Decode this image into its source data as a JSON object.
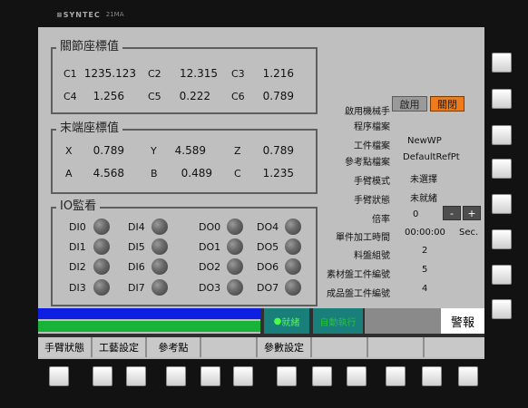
{
  "joint": {
    "title": "關節座標值",
    "items": [
      {
        "label": "C1",
        "value": "1235.123"
      },
      {
        "label": "C2",
        "value": "12.315"
      },
      {
        "label": "C3",
        "value": "1.216"
      },
      {
        "label": "C4",
        "value": "1.256"
      },
      {
        "label": "C5",
        "value": "0.222"
      },
      {
        "label": "C6",
        "value": "0.789"
      }
    ]
  },
  "endcoord": {
    "title": "末端座標值",
    "items": [
      {
        "label": "X",
        "value": "0.789"
      },
      {
        "label": "Y",
        "value": "4.589"
      },
      {
        "label": "Z",
        "value": "0.789"
      },
      {
        "label": "A",
        "value": "4.568"
      },
      {
        "label": "B",
        "value": "0.489"
      },
      {
        "label": "C",
        "value": "1.235"
      }
    ]
  },
  "io": {
    "title": "IO監看",
    "items": [
      {
        "label": "DI0"
      },
      {
        "label": "DI4"
      },
      {
        "label": "DO0"
      },
      {
        "label": "DO4"
      },
      {
        "label": "DI1"
      },
      {
        "label": "DI5"
      },
      {
        "label": "DO1"
      },
      {
        "label": "DO5"
      },
      {
        "label": "DI2"
      },
      {
        "label": "DI6"
      },
      {
        "label": "DO2"
      },
      {
        "label": "DO6"
      },
      {
        "label": "DI3"
      },
      {
        "label": "DI7"
      },
      {
        "label": "DO3"
      },
      {
        "label": "DO7"
      }
    ]
  },
  "status": {
    "enable_label": "啟用機械手",
    "enable_on": "啟用",
    "enable_off": "關閉",
    "rate_label": "倍率",
    "rate_value": "0",
    "minus": "-",
    "plus": "+",
    "time_label": "單件加工時間",
    "time_value": "00:00:00",
    "time_unit": "Sec.",
    "rows": [
      {
        "label": "程序檔案",
        "value": ""
      },
      {
        "label": "工件檔案",
        "value": "NewWP"
      },
      {
        "label": "參考點檔案",
        "value": "DefaultRefPt"
      },
      {
        "label": "手臂模式",
        "value": "未選擇"
      },
      {
        "label": "手臂狀態",
        "value": "未就緒"
      },
      {
        "label": "料盤組號",
        "value": "2"
      },
      {
        "label": "素材盤工件編號",
        "value": "5"
      },
      {
        "label": "成品盤工件編號",
        "value": "4"
      }
    ]
  },
  "statusbar": {
    "ready_dot": "●",
    "ready": "就緒",
    "auto_run": "自動執行",
    "alarm": "警報"
  },
  "softkeys": [
    "手臂狀態",
    "工藝設定",
    "參考點",
    "",
    "參數設定",
    "",
    "",
    ""
  ],
  "colors": {
    "screen_bg": "#bfbfbf",
    "blue_bar": "#0d1fe0",
    "green_bar": "#18b43a",
    "status_teal": "#187f7a",
    "disable_orange": "#f07b1a"
  }
}
